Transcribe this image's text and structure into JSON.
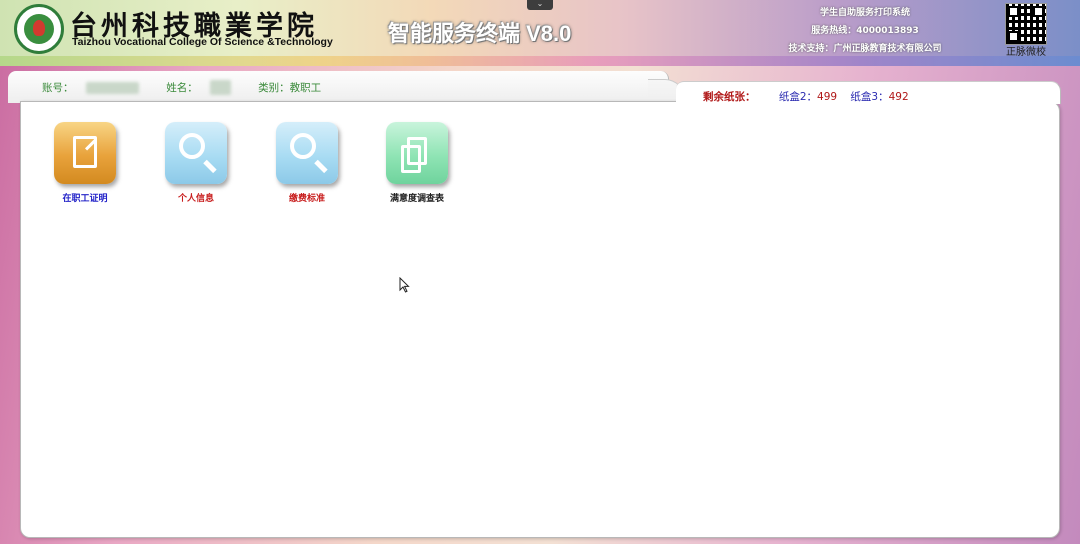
{
  "header": {
    "college_cn": "台州科技職業学院",
    "college_en": "Taizhou Vocational College Of Science &Technology",
    "terminal_title": "智能服务终端 V8.0",
    "system_name": "学生自助服务打印系统",
    "hotline": "服务热线：4000013893",
    "tech_support": "技术支持：广州正脉教育技术有限公司",
    "qr_caption": "正脉微校",
    "collapse_glyph": "⌄"
  },
  "info": {
    "account_label": "账号：",
    "account_value": "20210120",
    "name_label": "姓名：",
    "name_value": "某某",
    "category": "类别：教职工"
  },
  "paper": {
    "remaining_label": "剩余纸张：",
    "box2_label": "纸盒2：",
    "box2_count": "499",
    "box3_label": "纸盒3：",
    "box3_count": "492"
  },
  "tiles": [
    {
      "label": "在职工证明",
      "color": "#2323c8",
      "icon": "document-edit-icon"
    },
    {
      "label": "个人信息",
      "color": "#c81e1e",
      "icon": "magnifier-icon"
    },
    {
      "label": "缴费标准",
      "color": "#c81e1e",
      "icon": "magnifier-icon"
    },
    {
      "label": "满意度调查表",
      "color": "#222222",
      "icon": "pages-icon"
    }
  ]
}
